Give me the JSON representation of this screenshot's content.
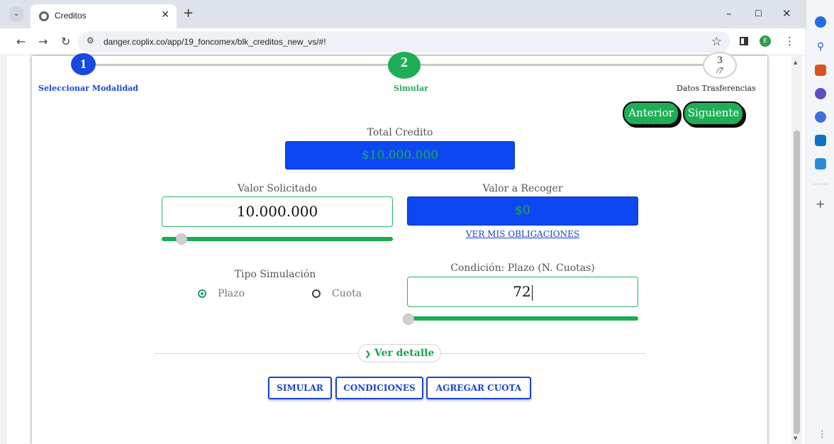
{
  "browser": {
    "tab_title": "Creditos",
    "url": "danger.coplix.co/app/19_foncomex/blk_creditos_new_vs/#!",
    "profile_initial": "E"
  },
  "stepper": {
    "steps": [
      {
        "number": "1",
        "label": "Seleccionar Modalidad"
      },
      {
        "number": "2",
        "label": "Simular"
      },
      {
        "number": "3",
        "total": "/7",
        "label": "Datos Trasferencias"
      }
    ]
  },
  "nav": {
    "prev_label": "Anterior",
    "next_label": "Siguiente"
  },
  "total_credito": {
    "label": "Total Credito",
    "value": "$10.000.000"
  },
  "valor_solicitado": {
    "label": "Valor Solicitado",
    "value": "10.000.000",
    "slider_fraction": 0.08
  },
  "valor_recoger": {
    "label": "Valor a Recoger",
    "value": "$0",
    "link": "VER MIS OBLIGACIONES"
  },
  "tipo_simulacion": {
    "label": "Tipo Simulación",
    "options": [
      {
        "label": "Plazo",
        "checked": true
      },
      {
        "label": "Cuota",
        "checked": false
      }
    ]
  },
  "condicion": {
    "label": "Condición: Plazo (N. Cuotas)",
    "value": "72",
    "slider_fraction": 0.0
  },
  "ver_detalle": "Ver detalle",
  "actions": [
    "SIMULAR",
    "CONDICIONES",
    "AGREGAR CUOTA"
  ],
  "colors": {
    "green": "#1dae56",
    "blue": "#0d47f2",
    "step_blue": "#1749e0"
  }
}
